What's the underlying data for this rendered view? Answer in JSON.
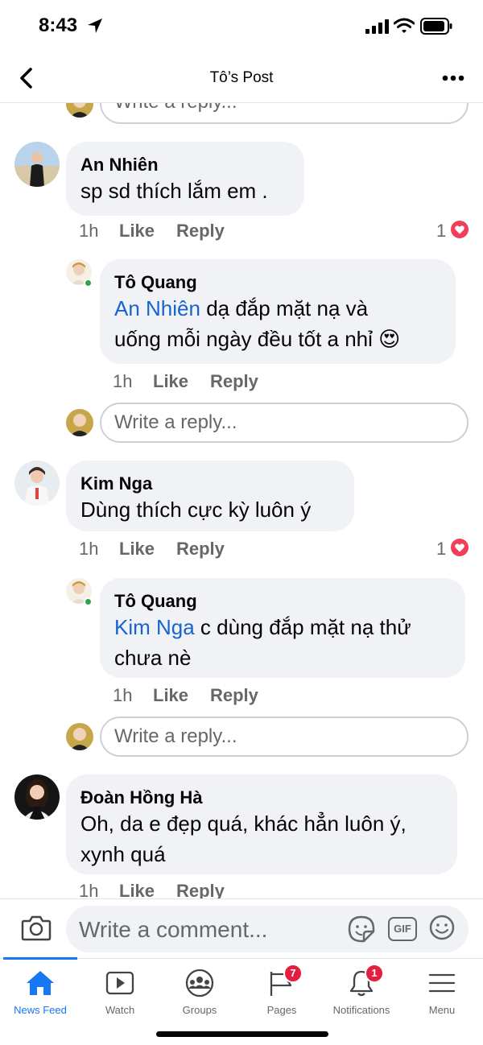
{
  "status_bar": {
    "time": "8:43"
  },
  "header": {
    "title": "Tô’s Post"
  },
  "reply_placeholder": "Write a reply...",
  "comments": [
    {
      "author": "An Nhiên",
      "text_lines": [
        "sp sd thích lắm em ."
      ],
      "time": "1h",
      "like_label": "Like",
      "reply_label": "Reply",
      "reaction_count": "1",
      "reply": {
        "author": "Tô Quang",
        "mention": "An Nhiên",
        "line1_rest": " dạ đắp mặt nạ và",
        "line2": "uống mỗi ngày đều tốt a nhỉ",
        "emoji": "😍",
        "time": "1h",
        "like_label": "Like",
        "reply_label": "Reply"
      }
    },
    {
      "author": "Kim Nga",
      "text_lines": [
        "Dùng thích cực kỳ luôn ý"
      ],
      "time": "1h",
      "like_label": "Like",
      "reply_label": "Reply",
      "reaction_count": "1",
      "reply": {
        "author": "Tô Quang",
        "mention": "Kim Nga",
        "line1_rest": " c dùng đắp mặt nạ thử",
        "line2": "chưa nè",
        "time": "1h",
        "like_label": "Like",
        "reply_label": "Reply"
      }
    },
    {
      "author": "Đoàn Hồng Hà",
      "text_lines": [
        "Oh, da e đẹp quá, khác hẳn luôn ý,",
        "xynh quá"
      ],
      "time": "1h",
      "like_label": "Like",
      "reply_label": "Reply"
    }
  ],
  "composer": {
    "placeholder": "Write a comment...",
    "gif_label": "GIF"
  },
  "tabs": [
    {
      "label": "News Feed",
      "icon": "home-icon",
      "active": true
    },
    {
      "label": "Watch",
      "icon": "watch-icon"
    },
    {
      "label": "Groups",
      "icon": "groups-icon"
    },
    {
      "label": "Pages",
      "icon": "pages-flag-icon",
      "badge": "7"
    },
    {
      "label": "Notifications",
      "icon": "bell-icon",
      "badge": "1"
    },
    {
      "label": "Menu",
      "icon": "menu-icon"
    }
  ],
  "colors": {
    "accent": "#1877f2",
    "mention": "#1763cf",
    "bubble": "#f0f2f5",
    "badge": "#e41e3f",
    "heart": "#f33e58",
    "muted": "#65676b"
  }
}
